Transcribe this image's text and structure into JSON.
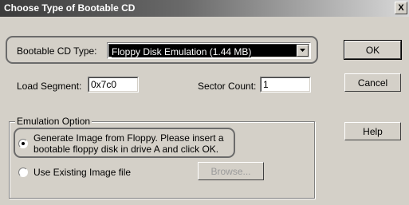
{
  "window": {
    "title": "Choose Type of Bootable CD",
    "close_label": "X"
  },
  "boot_type": {
    "label": "Bootable CD Type:",
    "selected": "Floppy Disk Emulation (1.44 MB)"
  },
  "load_segment": {
    "label": "Load Segment:",
    "value": "0x7c0"
  },
  "sector_count": {
    "label": "Sector Count:",
    "value": "1"
  },
  "emulation": {
    "group_label": "Emulation Option",
    "option_floppy_line1": "Generate Image from Floppy. Please insert a",
    "option_floppy_line2": "bootable floppy disk in drive A and click OK.",
    "option_existing": "Use Existing Image file",
    "browse_label": "Browse..."
  },
  "buttons": {
    "ok": "OK",
    "cancel": "Cancel",
    "help": "Help"
  },
  "icons": {
    "dropdown": "chevron-down-icon",
    "close": "close-icon"
  }
}
